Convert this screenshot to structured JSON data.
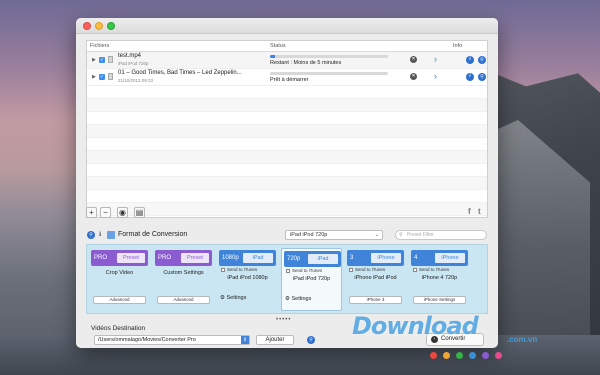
{
  "window": {
    "columns": {
      "files": "Fichiers",
      "status": "Status",
      "info": "Info"
    },
    "files": [
      {
        "name": "test.mp4",
        "meta": "iPad iPod 720p",
        "progress": 0.04,
        "status": "Restant : Moins de 5 minutes"
      },
      {
        "name": "01 – Good Times, Bad Times – Led Zeppelin...",
        "meta": "21/10/2013 09:23",
        "progress": 0.0,
        "status": "Prêt à démarrer"
      }
    ],
    "toolbar": {
      "add": "+",
      "remove": "−",
      "social_facebook": "f",
      "social_twitter": "t"
    },
    "format": {
      "title": "Format de Conversion",
      "selected": "iPad iPod 720p",
      "filter_placeholder": "Preset Filter"
    },
    "presets": [
      {
        "badge": "PRO",
        "inner": "Preset",
        "label": "Crop Video",
        "button": "Advanced",
        "type": "pro"
      },
      {
        "badge": "PRO",
        "inner": "Preset",
        "label": "Custom Settings",
        "button": "Advanced",
        "type": "pro"
      },
      {
        "badge": "1080p",
        "inner": "iPad",
        "send": "Send to iTunes",
        "label": "iPad iPod 1080p",
        "settings": "Settings",
        "type": "blue"
      },
      {
        "badge": "720p",
        "inner": "iPad",
        "send": "Send to iTunes",
        "label": "iPad iPod 720p",
        "settings": "Settings",
        "type": "blue",
        "active": true
      },
      {
        "badge": "3",
        "inner": "iPhone",
        "send": "Send to iTunes",
        "label": "iPhone iPad iPod",
        "button": "iPhone 3",
        "type": "blue"
      },
      {
        "badge": "4",
        "inner": "iPhone",
        "send": "Send to iTunes",
        "label": "iPhone 4 720p",
        "button": "iPhone Settings",
        "type": "blue"
      }
    ],
    "destination": {
      "title": "Vidéos Destination",
      "path": "/Users/ommalago/Movies/Converter Pro",
      "add_label": "Ajouter",
      "convert_label": "Convertir"
    }
  },
  "watermark": {
    "text": "Download",
    "suffix": ".com.vn"
  }
}
